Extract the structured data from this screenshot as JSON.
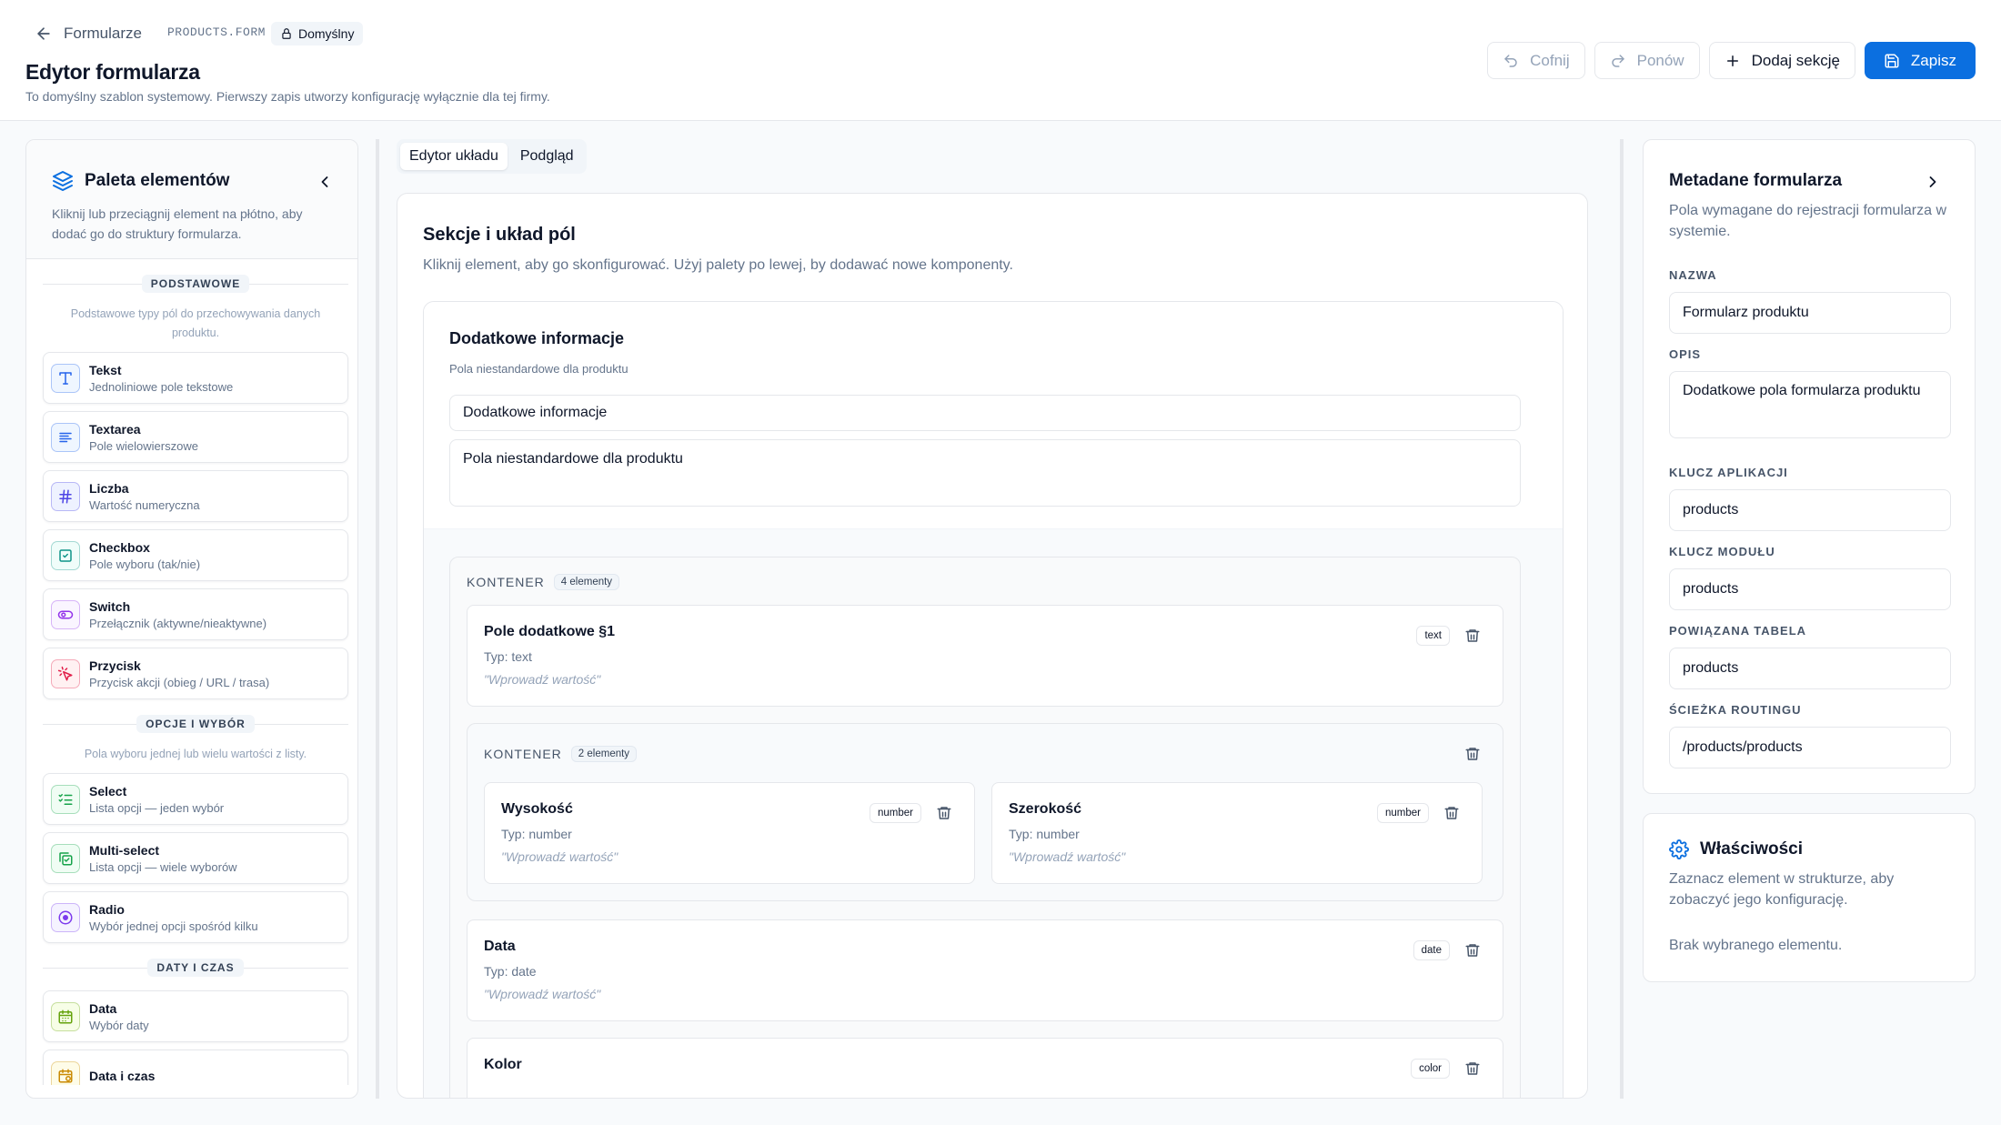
{
  "header": {
    "back_label": "Formularze",
    "app_key": "PRODUCTS.FORM",
    "template_badge": "Domyślny",
    "title": "Edytor formularza",
    "subtitle": "To domyślny szablon systemowy. Pierwszy zapis utworzy konfigurację wyłącznie dla tej firmy.",
    "toolbar": {
      "undo_label": "Cofnij",
      "redo_label": "Ponów",
      "add_section_label": "Dodaj sekcję",
      "save_label": "Zapisz"
    }
  },
  "colors": {
    "primary": "#0b6fe0",
    "border": "#e5e7eb",
    "muted_text": "#64748b"
  },
  "palette": {
    "title": "Paleta elementów",
    "description": "Kliknij lub przeciągnij element na płótno, aby dodać go do struktury formularza.",
    "groups": [
      {
        "label": "PODSTAWOWE",
        "description": "Podstawowe typy pól do przechowywania danych produktu.",
        "items": [
          {
            "label": "Tekst",
            "desc": "Jednoliniowe pole tekstowe",
            "icon": "text-type-icon",
            "color": "#2563eb",
            "bg": "#eff6ff"
          },
          {
            "label": "Textarea",
            "desc": "Pole wielowierszowe",
            "icon": "align-left-icon",
            "color": "#2563eb",
            "bg": "#eff6ff"
          },
          {
            "label": "Liczba",
            "desc": "Wartość numeryczna",
            "icon": "hash-icon",
            "color": "#4f46e5",
            "bg": "#eef2ff"
          },
          {
            "label": "Checkbox",
            "desc": "Pole wyboru (tak/nie)",
            "icon": "check-square-icon",
            "color": "#0d9488",
            "bg": "#f0fdfa"
          },
          {
            "label": "Switch",
            "desc": "Przełącznik (aktywne/nieaktywne)",
            "icon": "toggle-icon",
            "color": "#9333ea",
            "bg": "#faf5ff"
          },
          {
            "label": "Przycisk",
            "desc": "Przycisk akcji (obieg / URL / trasa)",
            "icon": "pointer-click-icon",
            "color": "#e11d48",
            "bg": "#fff1f2"
          }
        ]
      },
      {
        "label": "OPCJE I WYBÓR",
        "description": "Pola wyboru jednej lub wielu wartości z listy.",
        "items": [
          {
            "label": "Select",
            "desc": "Lista opcji — jeden wybór",
            "icon": "list-checks-icon",
            "color": "#16a34a",
            "bg": "#f0fdf4"
          },
          {
            "label": "Multi-select",
            "desc": "Lista opcji — wiele wyborów",
            "icon": "copy-check-icon",
            "color": "#16a34a",
            "bg": "#f0fdf4"
          },
          {
            "label": "Radio",
            "desc": "Wybór jednej opcji spośród kilku",
            "icon": "radio-dot-icon",
            "color": "#7c3aed",
            "bg": "#f5f3ff"
          }
        ]
      },
      {
        "label": "DATY I CZAS",
        "description": "",
        "items": [
          {
            "label": "Data",
            "desc": "Wybór daty",
            "icon": "calendar-icon",
            "color": "#65a30d",
            "bg": "#f7fee7"
          },
          {
            "label": "Data i czas",
            "desc": "",
            "icon": "calendar-clock-icon",
            "color": "#ca8a04",
            "bg": "#fefce8"
          }
        ]
      }
    ]
  },
  "tabs": [
    "Edytor układu",
    "Podgląd"
  ],
  "canvas": {
    "title": "Sekcje i układ pól",
    "description": "Kliknij element, aby go skonfigurować. Użyj palety po lewej, by dodawać nowe komponenty.",
    "section": {
      "title": "Dodatkowe informacje",
      "subtitle": "Pola niestandardowe dla produktu",
      "title_value": "Dodatkowe informacje",
      "description_value": "Pola niestandardowe dla produktu"
    },
    "container": {
      "label": "KONTENER",
      "count": "4 elementy",
      "fields": [
        {
          "name": "Pole dodatkowe §1",
          "type": "Typ: text",
          "placeholder": "\"Wprowadź wartość\"",
          "badge": "text"
        },
        {
          "name": "Data",
          "type": "Typ: date",
          "placeholder": "\"Wprowadź wartość\"",
          "badge": "date"
        },
        {
          "name": "Kolor",
          "badge": "color"
        }
      ],
      "nested": {
        "label": "KONTENER",
        "count": "2 elementy",
        "fields": [
          {
            "name": "Wysokość",
            "type": "Typ: number",
            "placeholder": "\"Wprowadź wartość\"",
            "badge": "number"
          },
          {
            "name": "Szerokość",
            "type": "Typ: number",
            "placeholder": "\"Wprowadź wartość\"",
            "badge": "number"
          }
        ]
      }
    }
  },
  "metadata": {
    "title": "Metadane formularza",
    "description": "Pola wymagane do rejestracji formularza w systemie.",
    "name_label": "NAZWA",
    "name_value": "Formularz produktu",
    "desc_label": "OPIS",
    "desc_value": "Dodatkowe pola formularza produktu",
    "app_key_label": "KLUCZ APLIKACJI",
    "app_key_value": "products",
    "module_key_label": "KLUCZ MODUŁU",
    "module_key_value": "products",
    "table_label": "POWIĄZANA TABELA",
    "table_value": "products",
    "route_label": "ŚCIEŻKA ROUTINGU",
    "route_value": "/products/products"
  },
  "properties": {
    "title": "Właściwości",
    "description": "Zaznacz element w strukturze, aby zobaczyć jego konfigurację.",
    "empty": "Brak wybranego elementu."
  }
}
